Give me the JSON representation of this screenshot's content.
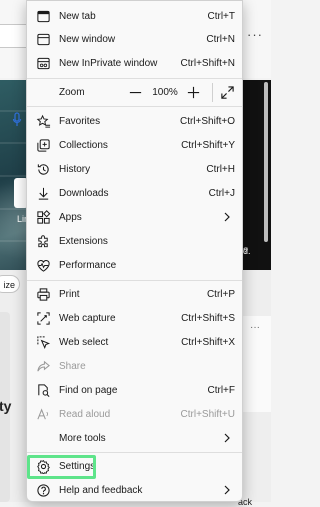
{
  "background": {
    "tile_label": "Lin",
    "chip_label": "ize",
    "card_text": "ty",
    "right_label": "d.",
    "right_label2": "?",
    "back_label": "ack",
    "more_icon": "more-horizontal-icon"
  },
  "menu": {
    "new_tab": {
      "label": "New tab",
      "shortcut": "Ctrl+T",
      "icon": "new-tab-icon"
    },
    "new_window": {
      "label": "New window",
      "shortcut": "Ctrl+N",
      "icon": "new-window-icon"
    },
    "new_inprivate": {
      "label": "New InPrivate window",
      "shortcut": "Ctrl+Shift+N",
      "icon": "inprivate-icon"
    },
    "zoom": {
      "label": "Zoom",
      "value": "100%",
      "minus_icon": "minus-icon",
      "plus_icon": "plus-icon",
      "fullscreen_icon": "fullscreen-icon"
    },
    "favorites": {
      "label": "Favorites",
      "shortcut": "Ctrl+Shift+O",
      "icon": "favorites-icon"
    },
    "collections": {
      "label": "Collections",
      "shortcut": "Ctrl+Shift+Y",
      "icon": "collections-icon"
    },
    "history": {
      "label": "History",
      "shortcut": "Ctrl+H",
      "icon": "history-icon"
    },
    "downloads": {
      "label": "Downloads",
      "shortcut": "Ctrl+J",
      "icon": "download-icon"
    },
    "apps": {
      "label": "Apps",
      "icon": "apps-icon"
    },
    "extensions": {
      "label": "Extensions",
      "icon": "extensions-icon"
    },
    "performance": {
      "label": "Performance",
      "icon": "performance-icon"
    },
    "print": {
      "label": "Print",
      "shortcut": "Ctrl+P",
      "icon": "print-icon"
    },
    "web_capture": {
      "label": "Web capture",
      "shortcut": "Ctrl+Shift+S",
      "icon": "web-capture-icon"
    },
    "web_select": {
      "label": "Web select",
      "shortcut": "Ctrl+Shift+X",
      "icon": "web-select-icon"
    },
    "share": {
      "label": "Share",
      "icon": "share-icon",
      "disabled": true
    },
    "find_on_page": {
      "label": "Find on page",
      "shortcut": "Ctrl+F",
      "icon": "find-icon"
    },
    "read_aloud": {
      "label": "Read aloud",
      "shortcut": "Ctrl+Shift+U",
      "icon": "read-aloud-icon",
      "disabled": true
    },
    "more_tools": {
      "label": "More tools"
    },
    "settings": {
      "label": "Settings",
      "icon": "settings-icon",
      "highlighted": true
    },
    "help_feedback": {
      "label": "Help and feedback",
      "icon": "help-icon"
    }
  },
  "colors": {
    "highlight": "#5ee48a",
    "disabled_text": "#9a9a9a",
    "accent": "#2f6fd6"
  }
}
